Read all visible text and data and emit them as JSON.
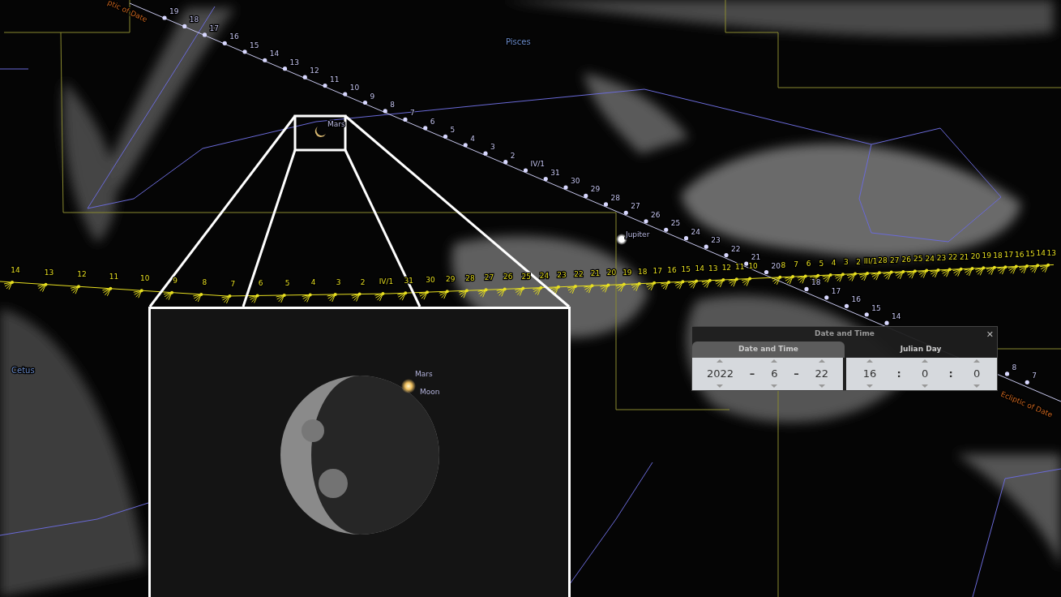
{
  "sky": {
    "constellations": [
      {
        "name": "Pisces"
      },
      {
        "name": "Cetus"
      }
    ],
    "objects": [
      {
        "name": "Mars"
      },
      {
        "name": "Jupiter"
      }
    ],
    "ecliptic_labels": [
      "ptic of Date",
      "Ecliptic of Date"
    ],
    "moon_track": {
      "labels": [
        "19",
        "18",
        "17",
        "16",
        "15",
        "14",
        "13",
        "12",
        "11",
        "10",
        "9",
        "8",
        "7",
        "6",
        "5",
        "4",
        "3",
        "2",
        "IV/1",
        "31",
        "30",
        "29",
        "28",
        "27",
        "26",
        "25",
        "24",
        "23",
        "22",
        "21",
        "20",
        "18",
        "17",
        "16",
        "15",
        "14",
        "8",
        "7"
      ]
    },
    "jupiter_track": {
      "labels": [
        "14",
        "13",
        "12",
        "11",
        "10",
        "9",
        "8",
        "7",
        "6",
        "5",
        "4",
        "3",
        "2",
        "IV/1",
        "31",
        "30",
        "29",
        "28",
        "27",
        "26",
        "25",
        "24",
        "23",
        "22",
        "21",
        "20",
        "19",
        "18",
        "17",
        "16",
        "15",
        "14",
        "13",
        "12",
        "11",
        "10",
        "8",
        "7",
        "6",
        "5",
        "4",
        "3",
        "2",
        "III/1",
        "28",
        "27",
        "26",
        "25",
        "24",
        "23",
        "22",
        "21",
        "20",
        "19",
        "18",
        "17",
        "16",
        "15",
        "14",
        "13"
      ]
    }
  },
  "inset": {
    "labels": [
      "Mars",
      "Moon"
    ]
  },
  "date_time_dialog": {
    "title": "Date and Time",
    "close": "✕",
    "tabs": [
      {
        "label": "Date and Time",
        "selected": true
      },
      {
        "label": "Julian Day",
        "selected": false
      }
    ],
    "groups": [
      [
        {
          "kind": "spin",
          "value": "2022"
        },
        {
          "kind": "sep",
          "text": "–"
        },
        {
          "kind": "spin",
          "value": "6"
        },
        {
          "kind": "sep",
          "text": "–"
        },
        {
          "kind": "spin",
          "value": "22"
        }
      ],
      [
        {
          "kind": "spin",
          "value": "16"
        },
        {
          "kind": "sep",
          "text": ":"
        },
        {
          "kind": "spin",
          "value": "0"
        },
        {
          "kind": "sep",
          "text": ":"
        },
        {
          "kind": "spin",
          "value": "0"
        }
      ]
    ]
  }
}
